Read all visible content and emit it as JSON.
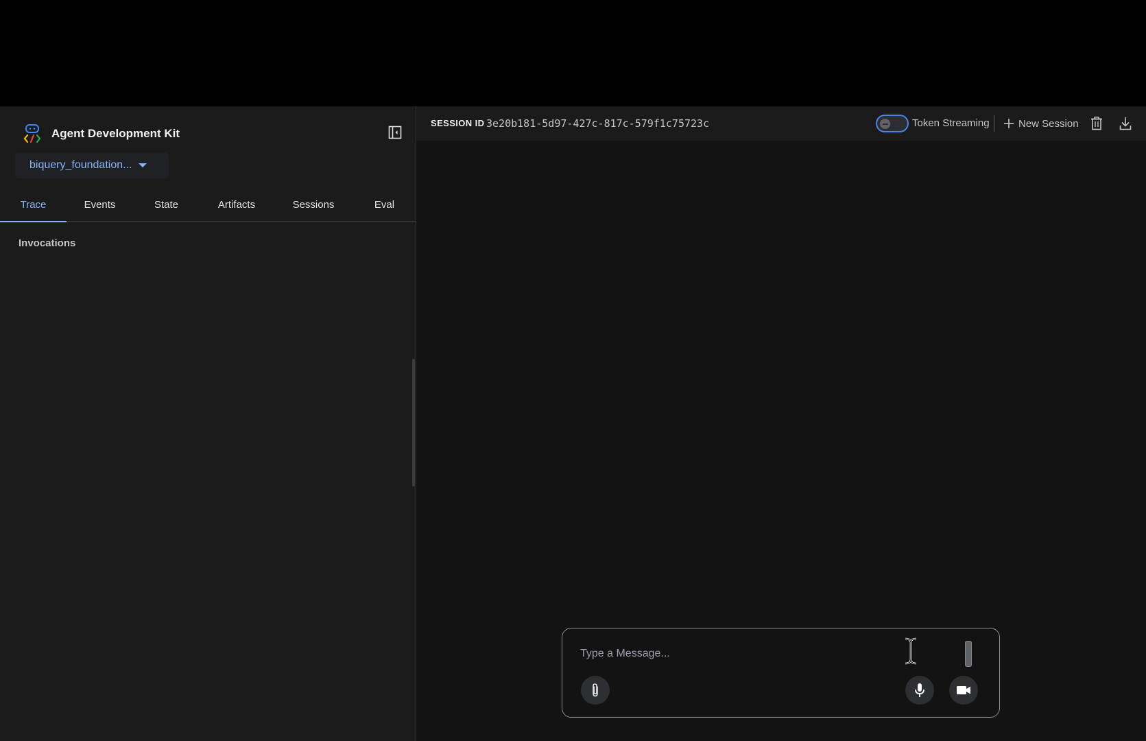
{
  "app": {
    "title": "Agent Development Kit"
  },
  "sidebar": {
    "agent_select": "biquery_foundation...",
    "tabs": [
      {
        "label": "Trace",
        "active": true
      },
      {
        "label": "Events",
        "active": false
      },
      {
        "label": "State",
        "active": false
      },
      {
        "label": "Artifacts",
        "active": false
      },
      {
        "label": "Sessions",
        "active": false
      },
      {
        "label": "Eval",
        "active": false
      }
    ],
    "section_label": "Invocations"
  },
  "session": {
    "label": "SESSION ID",
    "id": "3e20b181-5d97-427c-817c-579f1c75723c",
    "token_streaming_label": "Token Streaming",
    "token_streaming_enabled": false,
    "new_session_label": "New Session"
  },
  "composer": {
    "placeholder": "Type a Message...",
    "value": ""
  },
  "colors": {
    "accent": "#8ab4f8",
    "background": "#131314",
    "panel": "#1b1b1c"
  },
  "icons": {
    "brand": "adk-logo-icon",
    "collapse": "sidebar-collapse-icon",
    "add": "plus-icon",
    "delete": "trash-icon",
    "download": "download-icon",
    "attach": "paperclip-icon",
    "mic": "microphone-icon",
    "video": "video-camera-icon"
  }
}
